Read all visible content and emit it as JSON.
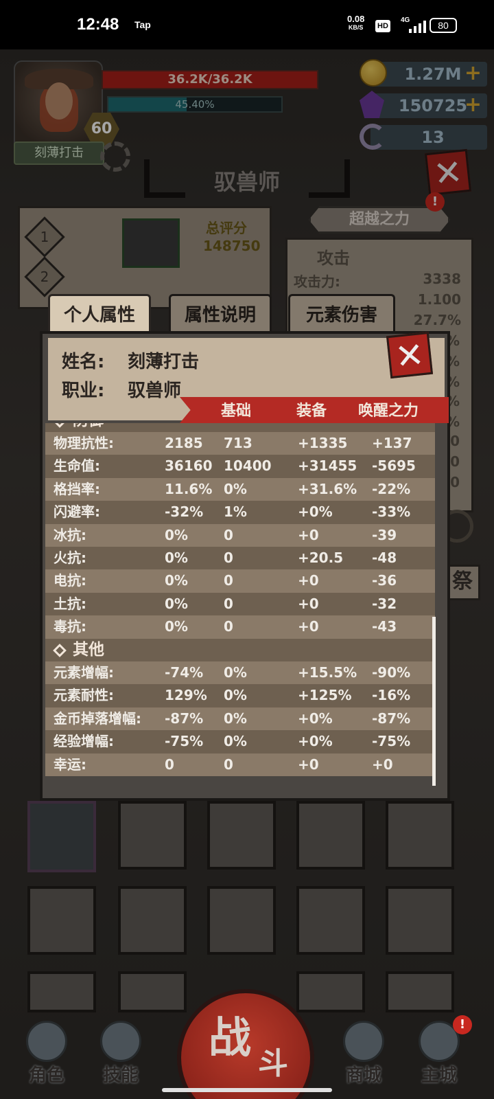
{
  "status_bar": {
    "time": "12:48",
    "app_tag": "Tap",
    "net_speed": "0.08",
    "net_unit": "KB/S",
    "hd": "HD",
    "network": "4G",
    "battery": "80"
  },
  "hero": {
    "level": "60",
    "hp_text": "36.2K/36.2K",
    "hp_fraction": 1.0,
    "xp_text": "45.40%",
    "xp_fraction": 0.454,
    "skill_name": "刻薄打击"
  },
  "currencies": {
    "gold": "1.27M",
    "crystals": "150725",
    "horns": "13",
    "plus": "+"
  },
  "page_title": "驭兽师",
  "close_glyph": "✕",
  "background": {
    "transcend_label": "超越之力",
    "alert": "!",
    "score_label": "总评分",
    "score_value": "148750",
    "slot_numbers": [
      "1",
      "2"
    ],
    "attack_title": "攻击",
    "attack_rows": [
      {
        "label": "攻击力:",
        "value": "3338"
      },
      {
        "label": "",
        "value": "1.100"
      },
      {
        "label": "",
        "value": "27.7%"
      }
    ],
    "side_values": [
      "%",
      "%",
      "%",
      "%",
      "%",
      "0",
      "0",
      "0"
    ],
    "side_button": "祭"
  },
  "tabs": [
    {
      "label": "个人属性",
      "active": true
    },
    {
      "label": "属性说明",
      "active": false
    },
    {
      "label": "元素伤害",
      "active": false
    }
  ],
  "modal": {
    "name_key": "姓名:",
    "name_value": "刻薄打击",
    "class_key": "职业:",
    "class_value": "驭兽师",
    "columns": [
      "基础",
      "装备",
      "唤醒之力"
    ],
    "partial_section": "防御",
    "rows": [
      {
        "label": "物理抗性:",
        "total": "2185",
        "base": "713",
        "equip": "+1335",
        "awaken": "+137"
      },
      {
        "label": "生命值:",
        "total": "36160",
        "base": "10400",
        "equip": "+31455",
        "awaken": "-5695"
      },
      {
        "label": "格挡率:",
        "total": "11.6%",
        "base": "0%",
        "equip": "+31.6%",
        "awaken": "-22%"
      },
      {
        "label": "闪避率:",
        "total": "-32%",
        "base": "1%",
        "equip": "+0%",
        "awaken": "-33%"
      },
      {
        "label": "冰抗:",
        "total": "0%",
        "base": "0",
        "equip": "+0",
        "awaken": "-39"
      },
      {
        "label": "火抗:",
        "total": "0%",
        "base": "0",
        "equip": "+20.5",
        "awaken": "-48"
      },
      {
        "label": "电抗:",
        "total": "0%",
        "base": "0",
        "equip": "+0",
        "awaken": "-36"
      },
      {
        "label": "土抗:",
        "total": "0%",
        "base": "0",
        "equip": "+0",
        "awaken": "-32"
      },
      {
        "label": "毒抗:",
        "total": "0%",
        "base": "0",
        "equip": "+0",
        "awaken": "-43"
      }
    ],
    "section_other": "其他",
    "rows_other": [
      {
        "label": "元素增幅:",
        "total": "-74%",
        "base": "0%",
        "equip": "+15.5%",
        "awaken": "-90%"
      },
      {
        "label": "元素耐性:",
        "total": "129%",
        "base": "0%",
        "equip": "+125%",
        "awaken": "-16%"
      },
      {
        "label": "金币掉落增幅:",
        "total": "-87%",
        "base": "0%",
        "equip": "+0%",
        "awaken": "-87%"
      },
      {
        "label": "经验增幅:",
        "total": "-75%",
        "base": "0%",
        "equip": "+0%",
        "awaken": "-75%"
      },
      {
        "label": "幸运:",
        "total": "0",
        "base": "0",
        "equip": "+0",
        "awaken": "+0"
      }
    ]
  },
  "nav": {
    "character": "角色",
    "skills": "技能",
    "battle_1": "战",
    "battle_2": "斗",
    "shop": "商城",
    "main_city": "主城",
    "alert": "!"
  },
  "colors": {
    "banner_red": "#b42a24",
    "row_light": "#8a7a68",
    "row_dark": "#6e6050",
    "hp_red": "#a8201a",
    "xp_teal": "#1e6a70"
  }
}
